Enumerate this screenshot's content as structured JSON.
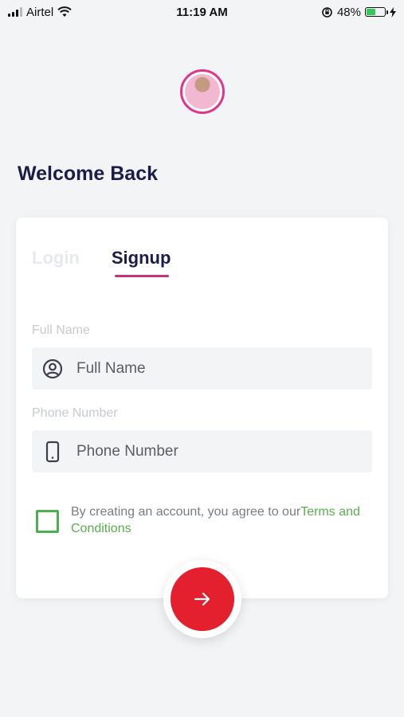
{
  "status_bar": {
    "carrier": "Airtel",
    "time": "11:19 AM",
    "battery": "48%",
    "battery_level": 0.48
  },
  "header": {
    "title": "Welcome Back"
  },
  "tabs": [
    {
      "label": "Login",
      "active": false
    },
    {
      "label": "Signup",
      "active": true
    }
  ],
  "form": {
    "full_name": {
      "label": "Full Name",
      "placeholder": "Full Name",
      "value": ""
    },
    "phone": {
      "label": "Phone Number",
      "placeholder": "Phone Number",
      "value": ""
    },
    "terms": {
      "text": "By creating an account, you agree to our",
      "link": "Terms and Conditions",
      "checked": false
    }
  },
  "colors": {
    "accent": "#c4337f",
    "fab": "#e4202f",
    "checkbox": "#4caf50",
    "link": "#5aae4e",
    "title": "#1b1d48"
  },
  "icons": {
    "full_name": "user-circle-icon",
    "phone": "phone-icon",
    "fab": "arrow-right-icon"
  }
}
